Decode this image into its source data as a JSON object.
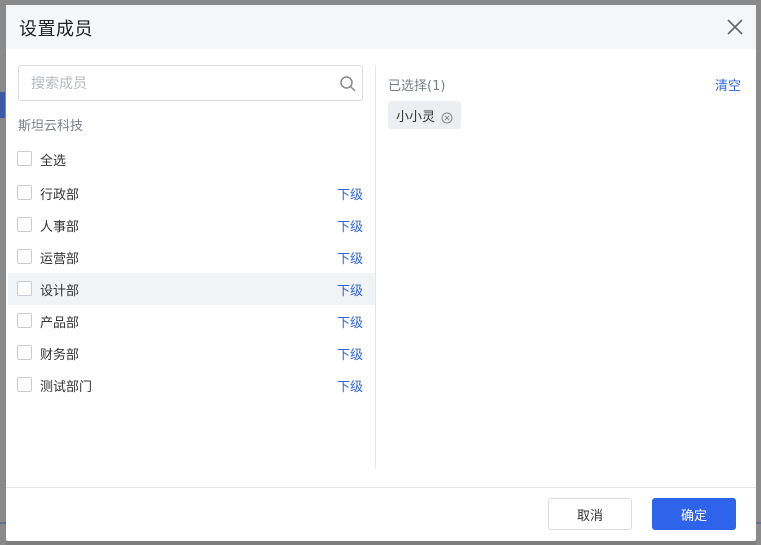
{
  "dialog": {
    "title": "设置成员"
  },
  "search": {
    "placeholder": "搜索成员",
    "value": ""
  },
  "organization": {
    "name": "斯坦云科技"
  },
  "list": {
    "select_all": "全选",
    "sub_label": "下级",
    "departments": [
      {
        "label": "行政部"
      },
      {
        "label": "人事部"
      },
      {
        "label": "运营部"
      },
      {
        "label": "设计部"
      },
      {
        "label": "产品部"
      },
      {
        "label": "财务部"
      },
      {
        "label": "测试部门"
      }
    ]
  },
  "selected": {
    "count_label": "已选择(1)",
    "clear_label": "清空",
    "items": [
      {
        "label": "小小灵"
      }
    ]
  },
  "footer": {
    "cancel_label": "取消",
    "ok_label": "确定"
  },
  "colors": {
    "accent": "#2f63e9",
    "link": "#2f66d9"
  }
}
